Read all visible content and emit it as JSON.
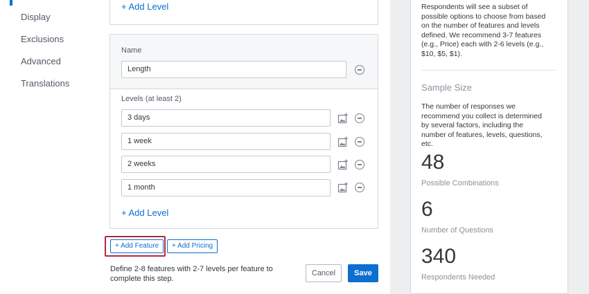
{
  "sidebar": {
    "items": [
      {
        "label": "Display"
      },
      {
        "label": "Exclusions"
      },
      {
        "label": "Advanced"
      },
      {
        "label": "Translations"
      }
    ]
  },
  "previous_feature": {
    "add_level_label": "+ Add Level"
  },
  "feature": {
    "name_label": "Name",
    "name_value": "Length",
    "levels_label": "Levels (at least 2)",
    "levels": [
      {
        "value": "3 days"
      },
      {
        "value": "1 week"
      },
      {
        "value": "2 weeks"
      },
      {
        "value": "1 month"
      }
    ],
    "add_level_label": "+ Add Level"
  },
  "actions": {
    "add_feature_label": "+ Add Feature",
    "add_pricing_label": "+ Add Pricing",
    "helper_text": "Define 2-8 features with 2-7 levels per feature to complete this step.",
    "cancel_label": "Cancel",
    "save_label": "Save"
  },
  "info_panel": {
    "intro_text": "Respondents will see a subset of possible options to choose from based on the number of features and levels defined. We recommend 3-7 features (e.g., Price) each with 2-6 levels (e.g., $10, $5, $1).",
    "sample_size_heading": "Sample Size",
    "sample_size_text": "The number of responses we recommend you collect is determined by several factors, including the number of features, levels, questions, etc.",
    "stats": [
      {
        "value": "48",
        "label": "Possible Combinations"
      },
      {
        "value": "6",
        "label": "Number of Questions"
      },
      {
        "value": "340",
        "label": "Respondents Needed"
      }
    ]
  },
  "colors": {
    "accent": "#0b6ed0",
    "highlight": "#b3293a"
  }
}
